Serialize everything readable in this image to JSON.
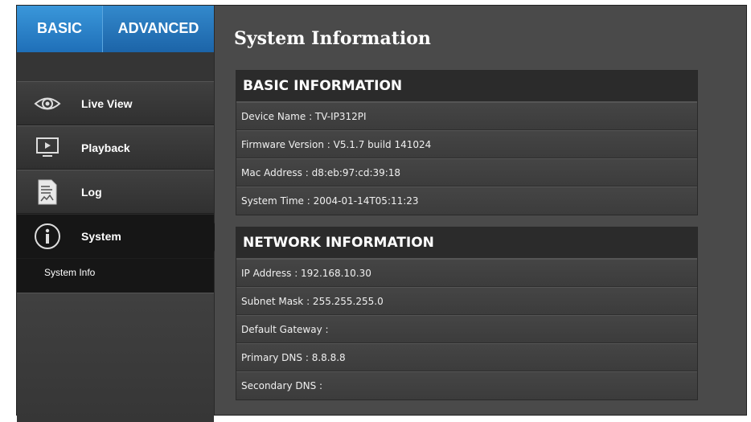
{
  "tabs": {
    "basic": "BASIC",
    "advanced": "ADVANCED"
  },
  "sidebar": {
    "items": [
      {
        "label": "Live View",
        "icon": "eye-icon"
      },
      {
        "label": "Playback",
        "icon": "playback-monitor-icon"
      },
      {
        "label": "Log",
        "icon": "log-document-icon"
      },
      {
        "label": "System",
        "icon": "info-icon"
      }
    ],
    "submenu": {
      "label": "System Info"
    }
  },
  "main": {
    "title": "System Information",
    "basic": {
      "header": "BASIC INFORMATION",
      "rows": [
        "Device Name : TV-IP312PI",
        "Firmware Version : V5.1.7 build 141024",
        "Mac Address : d8:eb:97:cd:39:18",
        "System Time : 2004-01-14T05:11:23"
      ]
    },
    "network": {
      "header": "NETWORK INFORMATION",
      "rows": [
        "IP Address : 192.168.10.30",
        "Subnet Mask : 255.255.255.0",
        "Default Gateway :",
        "Primary DNS : 8.8.8.8",
        "Secondary DNS :"
      ]
    }
  },
  "colors": {
    "accent": "#2a80c8",
    "panel_bg": "#3f3f3f",
    "frame_bg": "#4a4a4a"
  }
}
